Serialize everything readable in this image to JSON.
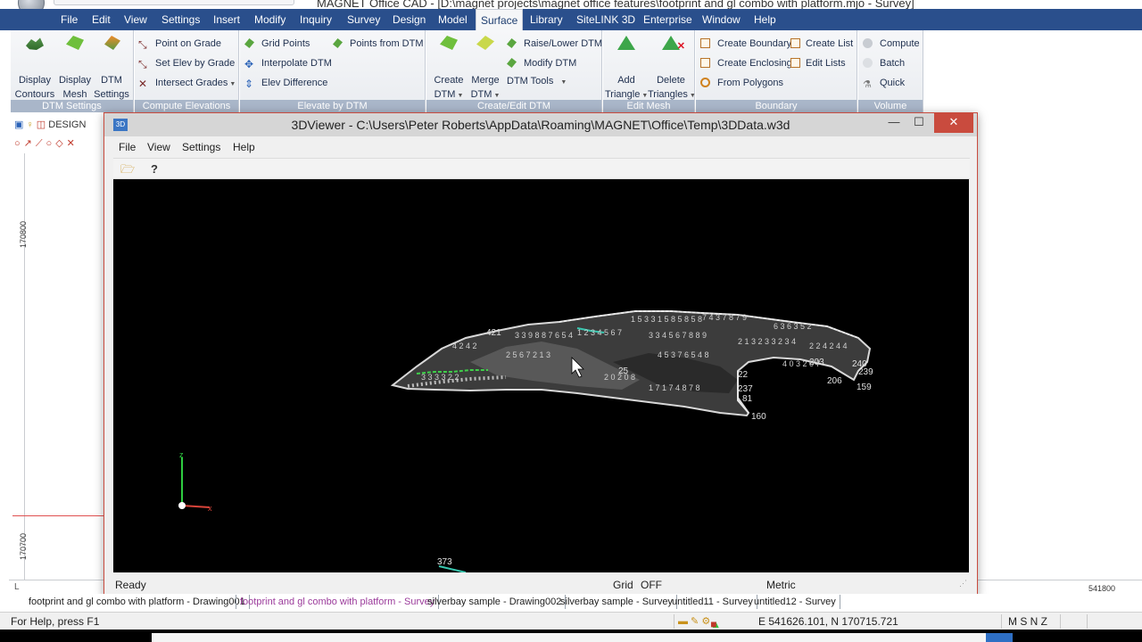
{
  "app": {
    "title_fragment": "MAGNET Office CAD - [D:\\magnet projects\\magnet office features\\footprint and gl combo with platform.mjo - Survey]"
  },
  "menubar": {
    "items": [
      "File",
      "Edit",
      "View",
      "Settings",
      "Insert",
      "Modify",
      "Inquiry",
      "Survey",
      "Design",
      "Model",
      "Surface",
      "Library",
      "SiteLINK 3D",
      "Enterprise",
      "Window",
      "Help"
    ],
    "active": "Surface"
  },
  "ribbon": {
    "dtm_settings": {
      "title": "DTM Settings",
      "display_contours": [
        "Display",
        "Contours"
      ],
      "display_mesh": [
        "Display",
        "Mesh"
      ],
      "dtm_settings": [
        "DTM",
        "Settings"
      ]
    },
    "compute_elevations": {
      "title": "Compute Elevations",
      "point_on_grade": "Point on Grade",
      "set_elev_by_grade": "Set Elev by Grade",
      "intersect_grades": "Intersect Grades"
    },
    "elevate_by_dtm": {
      "title": "Elevate by DTM",
      "grid_points": "Grid Points",
      "points_from_dtm": "Points from DTM",
      "interpolate_dtm": "Interpolate DTM",
      "elev_difference": "Elev Difference"
    },
    "create_edit_dtm": {
      "title": "Create/Edit DTM",
      "create_dtm": [
        "Create",
        "DTM"
      ],
      "merge_dtm": [
        "Merge",
        "DTM"
      ],
      "raise_lower_dtm": "Raise/Lower DTM",
      "modify_dtm": "Modify DTM",
      "dtm_tools": "DTM Tools"
    },
    "edit_mesh": {
      "title": "Edit Mesh",
      "add_triangle": [
        "Add",
        "Triangle"
      ],
      "delete_triangles": [
        "Delete",
        "Triangles"
      ]
    },
    "boundary": {
      "title": "Boundary",
      "create_boundary": "Create Boundary",
      "create_list": "Create List",
      "create_enclosing": "Create Enclosing",
      "edit_lists": "Edit Lists",
      "from_polygons": "From Polygons"
    },
    "volume": {
      "title": "Volume",
      "compute": "Compute",
      "batch": "Batch",
      "quick": "Quick"
    }
  },
  "drawing": {
    "layer_label": "DESIGN",
    "ruler_labels": [
      "170800",
      "170700"
    ],
    "hruler_right": "541800",
    "hruler_left": "L"
  },
  "viewer": {
    "title": "3DViewer - C:\\Users\\Peter Roberts\\AppData\\Roaming\\MAGNET\\Office\\Temp\\3DData.w3d",
    "app_icon": "3D",
    "menu": [
      "File",
      "View",
      "Settings",
      "Help"
    ],
    "toolbar": {
      "open_icon": "folder-open-icon",
      "help_icon": "help-icon"
    },
    "axis_labels": {
      "z": "z",
      "x": "x"
    },
    "terrain_point_labels": [
      "421",
      "25",
      "22",
      "240",
      "239",
      "159",
      "160",
      "206",
      "203",
      "237",
      "81",
      "91",
      "373"
    ],
    "status": {
      "ready": "Ready",
      "grid_label": "Grid",
      "grid_value": "OFF",
      "units": "Metric"
    }
  },
  "doc_tabs": {
    "items": [
      "footprint and gl combo with platform - Drawing001",
      "footprint and gl combo with platform - Survey",
      "silverbay sample - Drawing002",
      "silverbay sample - Survey",
      "untitled11 - Survey",
      "untitled12 - Survey"
    ],
    "active_index": 1
  },
  "statusbar": {
    "help_text": "For Help, press F1",
    "coords": "E 541626.101,  N 170715.721",
    "flags": "M S N Z"
  },
  "colors": {
    "menubar": "#2a4f8c",
    "ribbon_group_title": "#a9b6c9",
    "viewer_close": "#c94b3e",
    "active_tab_text": "#9b3b9b"
  }
}
